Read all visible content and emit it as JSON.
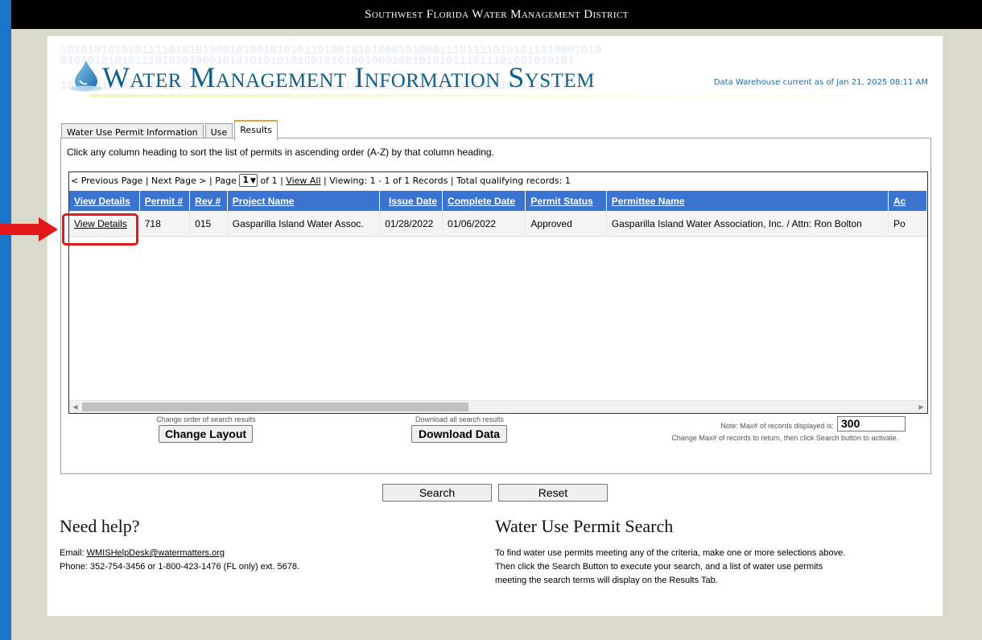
{
  "topbar": {
    "title": "Southwest Florida Water Management District"
  },
  "header": {
    "app_title": "Water Management Information System",
    "binary_line1": "10101010101011110101010001010010101011010010101000101000111011110101011110001010",
    "binary_line2": "0101010101011101010100010101010101010010101001000100101010111011101001010101",
    "binary_line3": "1010101010111101010100010100101010110100101010001010001110111101010111101010",
    "dw_status": "Data Warehouse current as of Jan 21, 2025 08:11 AM"
  },
  "tabs": [
    {
      "label": "Water Use Permit Information"
    },
    {
      "label": "Use"
    },
    {
      "label": "Results"
    }
  ],
  "results": {
    "instruction": "Click any column heading to sort the list of permits in ascending order (A-Z) by that column heading.",
    "pager": {
      "prev": "< Previous Page",
      "next": "Next Page >",
      "page_label": "Page",
      "page_value": "1",
      "of_text": "of 1",
      "view_all": "View All",
      "viewing": "Viewing: 1 - 1 of 1 Records",
      "total": "Total qualifying records: 1",
      "sep": "|"
    },
    "columns": [
      "View Details",
      "Permit #",
      "Rev #",
      "Project Name",
      "Issue Date",
      "Complete Date",
      "Permit Status",
      "Permittee Name",
      "Ac"
    ],
    "row": {
      "view_details": "View Details",
      "permit": "718",
      "rev": "015",
      "project": "Gasparilla Island Water Assoc.",
      "issue_date": "01/28/2022",
      "complete_date": "01/06/2022",
      "status": "Approved",
      "permittee": "Gasparilla Island Water Association, Inc. / Attn: Ron Bolton",
      "ac": "Po"
    },
    "change_layout_caption": "Change order of search results",
    "change_layout_label": "Change Layout",
    "download_caption": "Download all search results",
    "download_label": "Download Data",
    "max_note": "Note: Max# of records displayed is:",
    "max_value": "300",
    "max_hint": "Change Max# of records to return, then click Search button to activate."
  },
  "actions": {
    "search": "Search",
    "reset": "Reset"
  },
  "help": {
    "heading": "Need help?",
    "email_label": "Email:",
    "email": "WMISHelpDesk@watermatters.org",
    "phone": "Phone: 352-754-3456 or 1-800-423-1476 (FL only) ext. 5678."
  },
  "about": {
    "heading": "Water Use Permit Search",
    "line1": "To find water use permits meeting any of the criteria, make one or more selections above.",
    "line2": "Then click the Search Button to execute your search, and a list of water use permits",
    "line3": "meeting the search terms will display on the Results Tab."
  },
  "colors": {
    "page_bg": "#1a75c9",
    "frame": "#d9d9cc",
    "header_cell": "#3b73d1",
    "title": "#0f5f88",
    "highlight": "#e31818",
    "active_tab_border": "#e0a43a"
  },
  "annotation": {
    "arrow": "arrow-right-icon",
    "highlight": "highlight-box"
  }
}
